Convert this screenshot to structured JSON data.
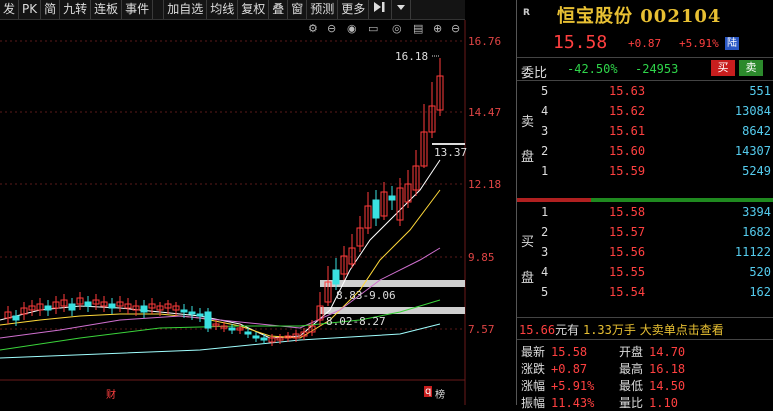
{
  "toolbar": {
    "items": [
      "发",
      "PK",
      "简",
      "九转",
      "连板",
      "事件",
      "加自选",
      "均线",
      "复权",
      "叠",
      "窗",
      "预测",
      "更多"
    ],
    "nav_icon": "skip-icon",
    "dropdown_icon": "caret-down-icon"
  },
  "chart": {
    "price_labels": [
      "16.76",
      "14.47",
      "12.18",
      "9.85",
      "7.57"
    ],
    "high_marker": "16.18",
    "low_marker": "13.37",
    "zone1": "8.83-9.06",
    "zone2": "8.02-8.27",
    "tag_cai": "财",
    "tag_q": "q",
    "tag_bang": "榜",
    "ctrl_icons": [
      "settings-icon",
      "zoom-out-icon",
      "eye-icon",
      "eye-off-icon",
      "panel-icon",
      "plus-circle-icon",
      "minus-circle-icon"
    ],
    "colors": {
      "up": "#ff3b3b",
      "down": "#3ae0e0",
      "ma5": "#ffffff",
      "ma10": "#ffd93a",
      "ma20": "#d070d0",
      "ma60": "#3bd43b"
    }
  },
  "quote": {
    "badge": "R",
    "name": "恒宝股份",
    "code": "002104",
    "price": "15.58",
    "change": "+0.87",
    "pct": "+5.91%",
    "market": "陆"
  },
  "order_book": {
    "wb_label": "委比",
    "wb_pct": "-42.50%",
    "wb_diff": "-24953",
    "sell_button": "买",
    "buy_button": "卖",
    "sell_side_chars": [
      "卖",
      "盘"
    ],
    "buy_side_chars": [
      "买",
      "盘"
    ],
    "asks": [
      {
        "level": "5",
        "price": "15.63",
        "vol": "551"
      },
      {
        "level": "4",
        "price": "15.62",
        "vol": "13084"
      },
      {
        "level": "3",
        "price": "15.61",
        "vol": "8642"
      },
      {
        "level": "2",
        "price": "15.60",
        "vol": "14307"
      },
      {
        "level": "1",
        "price": "15.59",
        "vol": "5249"
      }
    ],
    "bids": [
      {
        "level": "1",
        "price": "15.58",
        "vol": "3394"
      },
      {
        "level": "2",
        "price": "15.57",
        "vol": "1682"
      },
      {
        "level": "3",
        "price": "15.56",
        "vol": "11122"
      },
      {
        "level": "4",
        "price": "15.55",
        "vol": "520"
      },
      {
        "level": "5",
        "price": "15.54",
        "vol": "162"
      }
    ]
  },
  "ticker": {
    "price": "15.66",
    "unit": "元有",
    "vol": "1.33",
    "vol_unit": "万手",
    "big": "大卖单点击查看"
  },
  "stats": [
    {
      "label": "最新",
      "value": "15.58",
      "label2": "开盘",
      "value2": "14.70"
    },
    {
      "label": "涨跌",
      "value": "+0.87",
      "label2": "最高",
      "value2": "16.18"
    },
    {
      "label": "涨幅",
      "value": "+5.91%",
      "label2": "最低",
      "value2": "14.50"
    },
    {
      "label": "振幅",
      "value": "11.43%",
      "label2": "量比",
      "value2": "1.10"
    }
  ]
}
